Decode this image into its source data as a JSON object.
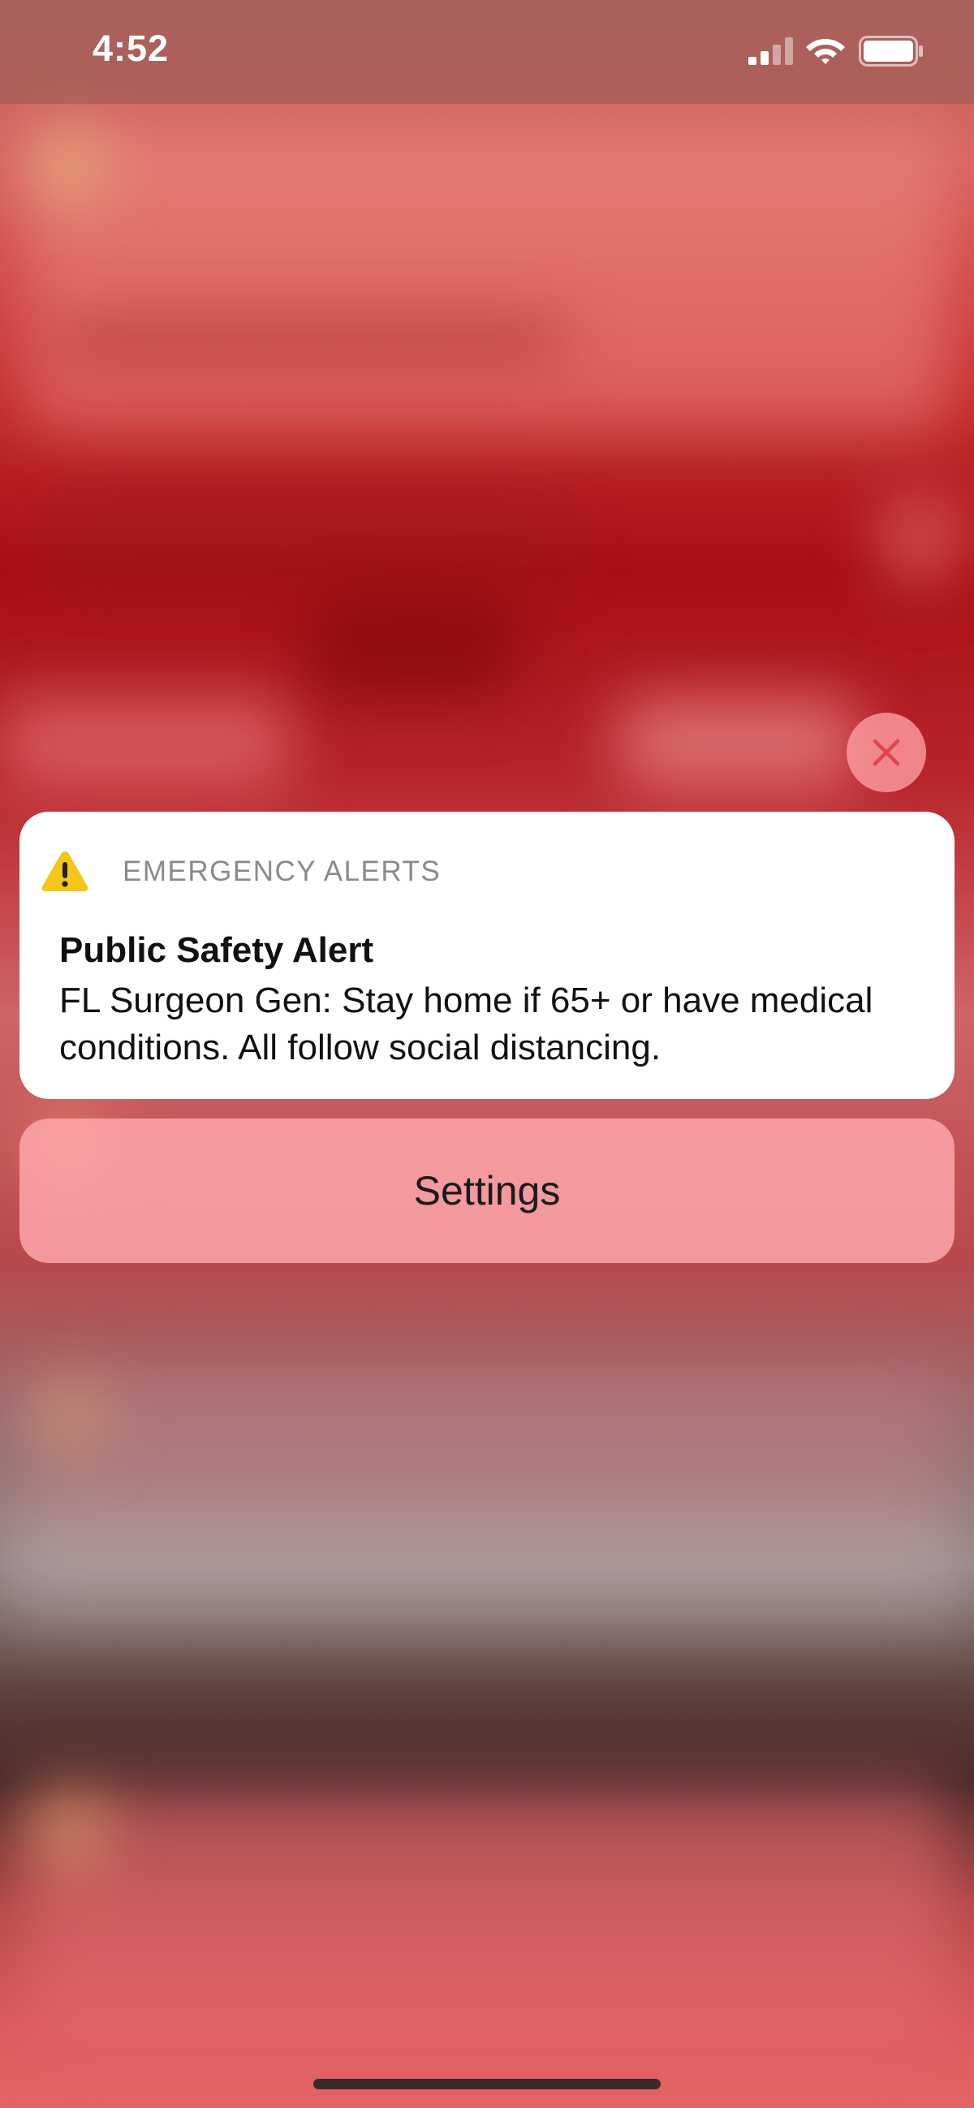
{
  "status_bar": {
    "time": "4:52",
    "signal_icon": "cellular-signal-icon",
    "wifi_icon": "wifi-icon",
    "battery_icon": "battery-full-icon"
  },
  "close_button": {
    "icon": "close-icon",
    "color": "#e0474c"
  },
  "alert": {
    "icon": "warning-icon",
    "icon_color": "#f5c518",
    "category": "EMERGENCY ALERTS",
    "title": "Public Safety Alert",
    "body": "FL Surgeon Gen: Stay home if 65+ or have medical conditions. All follow social distancing."
  },
  "settings_button": {
    "label": "Settings"
  }
}
